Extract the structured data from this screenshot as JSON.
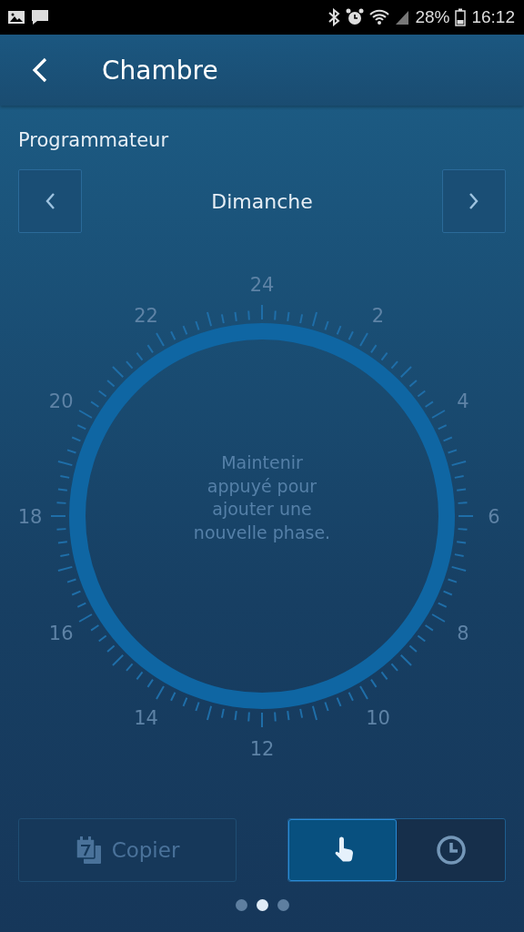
{
  "status_bar": {
    "battery": "28%",
    "time": "16:12"
  },
  "header": {
    "title": "Chambre"
  },
  "section_title": "Programmateur",
  "day_nav": {
    "day": "Dimanche"
  },
  "dial": {
    "hour_labels": [
      "24",
      "2",
      "4",
      "6",
      "8",
      "10",
      "12",
      "14",
      "16",
      "18",
      "20",
      "22"
    ],
    "hint": "Maintenir appuyé pour ajouter une nouvelle phase."
  },
  "copy_button": {
    "label": "Copier",
    "disabled": true
  },
  "mode_toggle": [
    {
      "kind": "touch",
      "selected": true
    },
    {
      "kind": "clock",
      "selected": false
    }
  ],
  "pager": [
    {
      "selected": false
    },
    {
      "selected": true
    },
    {
      "selected": false
    }
  ]
}
